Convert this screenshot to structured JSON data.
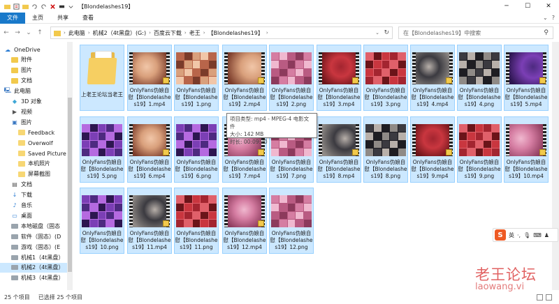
{
  "window": {
    "title": "【Blondelashes19】"
  },
  "ribbon": {
    "file_tab": "文件",
    "tabs": [
      "主页",
      "共享",
      "查看"
    ]
  },
  "address": {
    "crumbs": [
      "此电脑",
      "机械2（4t黑盘）(G:)",
      "百度云下载",
      "老王",
      "【Blondelashes19】"
    ]
  },
  "search": {
    "placeholder": "在【Blondelashes19】中搜索"
  },
  "nav": {
    "items": [
      {
        "label": "OneDrive",
        "icon": "cloud-icon",
        "indent": 0
      },
      {
        "label": "附件",
        "icon": "folder-icon",
        "indent": 1
      },
      {
        "label": "图片",
        "icon": "folder-icon",
        "indent": 1
      },
      {
        "label": "文档",
        "icon": "folder-icon",
        "indent": 1
      },
      {
        "label": "此电脑",
        "icon": "computer-icon",
        "indent": 0
      },
      {
        "label": "3D 对象",
        "icon": "cube-icon",
        "indent": 1
      },
      {
        "label": "视频",
        "icon": "video-icon",
        "indent": 1
      },
      {
        "label": "图片",
        "icon": "pictures-icon",
        "indent": 1
      },
      {
        "label": "Feedback",
        "icon": "folder-icon",
        "indent": 2
      },
      {
        "label": "Overwolf",
        "icon": "folder-icon",
        "indent": 2
      },
      {
        "label": "Saved Picture",
        "icon": "folder-icon",
        "indent": 2
      },
      {
        "label": "本机照片",
        "icon": "folder-icon",
        "indent": 2
      },
      {
        "label": "屏幕截图",
        "icon": "folder-icon",
        "indent": 2
      },
      {
        "label": "文档",
        "icon": "document-icon",
        "indent": 1
      },
      {
        "label": "下载",
        "icon": "download-icon",
        "indent": 1
      },
      {
        "label": "音乐",
        "icon": "music-icon",
        "indent": 1
      },
      {
        "label": "桌面",
        "icon": "desktop-icon",
        "indent": 1
      },
      {
        "label": "本地磁盘（固态",
        "icon": "drive-icon",
        "indent": 1
      },
      {
        "label": "软件（固态）(D",
        "icon": "drive-icon",
        "indent": 1
      },
      {
        "label": "游戏（固态）(E",
        "icon": "drive-icon",
        "indent": 1
      },
      {
        "label": "机械1（4t黑盘）",
        "icon": "drive-icon",
        "indent": 1
      },
      {
        "label": "机械2（4t黑盘）",
        "icon": "drive-icon",
        "indent": 1,
        "selected": true
      },
      {
        "label": "机械3（4t黑盘）",
        "icon": "drive-icon",
        "indent": 1
      }
    ]
  },
  "files": [
    {
      "label": "上老王论坛当老王",
      "kind": "folder"
    },
    {
      "label": "OnlyFans伪娘自慰【Blondelashes19】1.mp4",
      "kind": "video",
      "theme": "warm"
    },
    {
      "label": "OnlyFans伪娘自慰【Blondelashes19】1.png",
      "kind": "grid",
      "theme": "warm"
    },
    {
      "label": "OnlyFans伪娘自慰【Blondelashes19】2.mp4",
      "kind": "video",
      "theme": "warm"
    },
    {
      "label": "OnlyFans伪娘自慰【Blondelashes19】2.png",
      "kind": "grid",
      "theme": "pink"
    },
    {
      "label": "OnlyFans伪娘自慰【Blondelashes19】3.mp4",
      "kind": "video",
      "theme": "red"
    },
    {
      "label": "OnlyFans伪娘自慰【Blondelashes19】3.png",
      "kind": "grid",
      "theme": "red"
    },
    {
      "label": "OnlyFans伪娘自慰【Blondelashes19】4.mp4",
      "kind": "video",
      "theme": "dark"
    },
    {
      "label": "OnlyFans伪娘自慰【Blondelashes19】4.png",
      "kind": "grid",
      "theme": "dark"
    },
    {
      "label": "OnlyFans伪娘自慰【Blondelashes19】5.mp4",
      "kind": "video",
      "theme": "purple"
    },
    {
      "label": "OnlyFans伪娘自慰【Blondelashes19】5.png",
      "kind": "grid",
      "theme": "purple"
    },
    {
      "label": "OnlyFans伪娘自慰【Blondelashes19】6.mp4",
      "kind": "video",
      "theme": "warm"
    },
    {
      "label": "OnlyFans伪娘自慰【Blondelashes19】6.png",
      "kind": "grid",
      "theme": "purple"
    },
    {
      "label": "OnlyFans伪娘自慰【Blondelashes19】7.mp4",
      "kind": "video",
      "theme": "pink"
    },
    {
      "label": "OnlyFans伪娘自慰【Blondelashes19】7.png",
      "kind": "grid",
      "theme": "pink"
    },
    {
      "label": "OnlyFans伪娘自慰【Blondelashes19】8.mp4",
      "kind": "video",
      "theme": "dark"
    },
    {
      "label": "OnlyFans伪娘自慰【Blondelashes19】8.png",
      "kind": "grid",
      "theme": "dark"
    },
    {
      "label": "OnlyFans伪娘自慰【Blondelashes19】9.mp4",
      "kind": "video",
      "theme": "red"
    },
    {
      "label": "OnlyFans伪娘自慰【Blondelashes19】9.png",
      "kind": "grid",
      "theme": "red"
    },
    {
      "label": "OnlyFans伪娘自慰【Blondelashes19】10.mp4",
      "kind": "video",
      "theme": "pink"
    },
    {
      "label": "OnlyFans伪娘自慰【Blondelashes19】10.png",
      "kind": "grid",
      "theme": "purple"
    },
    {
      "label": "OnlyFans伪娘自慰【Blondelashes19】11.mp4",
      "kind": "video",
      "theme": "dark"
    },
    {
      "label": "OnlyFans伪娘自慰【Blondelashes19】11.png",
      "kind": "grid",
      "theme": "red"
    },
    {
      "label": "OnlyFans伪娘自慰【Blondelashes19】12.mp4",
      "kind": "video",
      "theme": "pink"
    },
    {
      "label": "OnlyFans伪娘自慰【Blondelashes19】12.png",
      "kind": "grid",
      "theme": "pink"
    }
  ],
  "tooltip": {
    "type": "项目类型: mp4 - MPEG-4 电影文件",
    "size": "大小: 142 MB",
    "duration": "时长: 00:09:20"
  },
  "status": {
    "count": "25 个项目",
    "selected": "已选择 25 个项目"
  },
  "ime": {
    "lang": "英"
  },
  "watermark": {
    "cn": "老王论坛",
    "url": "laowang.vi"
  },
  "colors": {
    "selection_bg": "#cce8ff",
    "selection_border": "#99d1ff",
    "file_tab": "#1979ca"
  }
}
